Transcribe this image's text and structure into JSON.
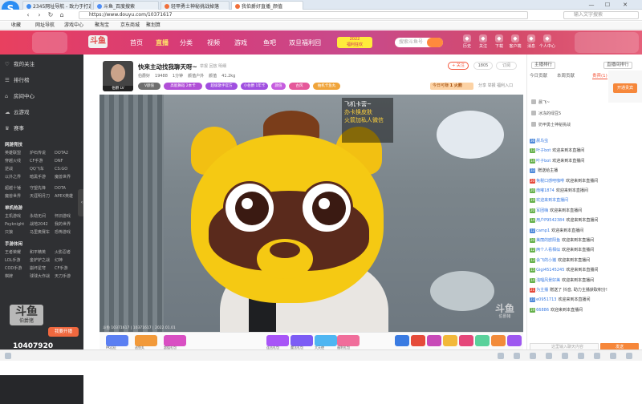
{
  "browser": {
    "tabs": [
      {
        "label": "2345网址导航 - 致力于打造",
        "color": "#3d8cf0"
      },
      {
        "label": "斗鱼_百度搜索",
        "color": "#4f8ef7"
      },
      {
        "label": "轻甲勇士神秘挑战掉落",
        "color": "#f06f3a"
      },
      {
        "label": "我伯爵好直播_颜值",
        "color": "#f06f3a"
      }
    ],
    "url": "https://www.douyu.com/10371617",
    "search_placeholder": "输入文字搜索",
    "bookmarks": [
      "收藏",
      "网址导航",
      "游戏中心",
      "聚淘宝",
      "京东商城",
      "聚划算"
    ]
  },
  "site_header": {
    "logo": "斗鱼",
    "nav": [
      "首页",
      "直播",
      "分类",
      "视频",
      "游戏",
      "鱼吧",
      "双旦福利回"
    ],
    "active_nav": "直播",
    "search_placeholder": "搜索斗鱼号",
    "icons": [
      {
        "label": "历史",
        "icon": "clock-icon"
      },
      {
        "label": "关注",
        "icon": "heart-icon"
      },
      {
        "label": "下载",
        "icon": "download-icon"
      },
      {
        "label": "客户端",
        "icon": "monitor-icon"
      },
      {
        "label": "消息",
        "icon": "message-icon"
      },
      {
        "label": "个人中心",
        "icon": "user-icon"
      }
    ]
  },
  "sidebar": {
    "items": [
      {
        "label": "我的关注",
        "icon": "heart-icon"
      },
      {
        "label": "排行榜",
        "icon": "list-icon"
      },
      {
        "label": "房间中心",
        "icon": "home-icon"
      },
      {
        "label": "云游戏",
        "icon": "cloud-icon"
      },
      {
        "label": "赛事",
        "icon": "trophy-icon"
      }
    ],
    "groups": [
      {
        "title": "网游竞技",
        "rows": [
          [
            "英雄联盟",
            "炉石传说",
            "DOTA2"
          ],
          [
            "穿越火线",
            "CF手游",
            "DNF"
          ],
          [
            "逆战",
            "QQ飞车",
            "CS:GO"
          ],
          [
            "以外之界",
            "暗黑手游",
            "魔兽世界"
          ]
        ]
      },
      {
        "title": "",
        "rows": [
          [
            "超越十锤",
            "守望先锋",
            "DOTA"
          ],
          [
            "魔兽世界",
            "天涯明月刀",
            "APEX英雄"
          ]
        ]
      },
      {
        "title": "单机热游",
        "rows": [
          [
            "主机游戏",
            "永劫无间",
            "怀旧游戏"
          ],
          [
            "Psyknight",
            "战地2042",
            "我的世界"
          ],
          [
            "只狼",
            "马里奥赛车",
            "恐怖游戏"
          ]
        ]
      },
      {
        "title": "手游休闲",
        "rows": [
          [
            "王者荣耀",
            "和平精英",
            "火影忍者"
          ],
          [
            "LOL手游",
            "金铲铲之战",
            "幻神"
          ],
          [
            "COD手游",
            "崩坏星穹",
            "CF手游"
          ],
          [
            "棋牌",
            "球球大作战",
            "天刀手游"
          ]
        ]
      }
    ],
    "dy_logo": "斗鱼",
    "dy_logo_sub": "伯爵猪",
    "start_button": "我要开播",
    "followers": "10407920"
  },
  "room": {
    "title": "快来主动找我聊天呀~",
    "subtitle": "举报  回放  明细",
    "info": [
      "伯爵好",
      "19488",
      "1分钟",
      "颜值户外",
      "颜值",
      "41.2kg"
    ],
    "badges": [
      {
        "label": "V颜值",
        "color": "#6e6e6e"
      },
      {
        "label": "高能舞蹈 2本卡",
        "color": "#b14fd7"
      },
      {
        "label": "超级歌手官方",
        "color": "#a04fe0"
      },
      {
        "label": "小伯爵 1年卡",
        "color": "#a04fe0"
      },
      {
        "label": "颜值",
        "color": "#c65cdf"
      },
      {
        "label": "古风",
        "color": "#e5589a"
      },
      {
        "label": "抽机卡鱼丸",
        "color": "#f0a43a"
      }
    ],
    "avatar_tag": "伯爵 LV",
    "follow_label": "+ 关注",
    "follow_count": "1805",
    "right_label": "订阅",
    "rank_label": "今日可赚",
    "rank_value": "1 火箭",
    "share_label": "分享  举报  福利入口"
  },
  "video": {
    "overlay_lines": [
      {
        "text": "飞机卡营~",
        "hl": false
      },
      {
        "text": "办卡换皮肤",
        "hl": true
      },
      {
        "text": "火箭加私人微信",
        "hl": true
      }
    ],
    "watermark": "斗鱼",
    "watermark_sub": "伯爵猪",
    "info": "斗鱼 10371617 | 10371617 | 2022.01.01"
  },
  "gifts": [
    {
      "label": "PK远征",
      "color": "#5b7ff2"
    },
    {
      "label": "送鱼丸",
      "color": "#f29a3a"
    },
    {
      "label": "超值礼包",
      "color": "#d94fc3"
    },
    {
      "label": "连击礼包",
      "color": "#a855f7"
    },
    {
      "label": "魔法礼包",
      "color": "#7c5cf5"
    },
    {
      "label": "大天使",
      "color": "#4fb6f2"
    },
    {
      "label": "福利礼包",
      "color": "#f06e9b"
    },
    {
      "label": "飞机",
      "color": "#3a7be2"
    },
    {
      "label": "火箭",
      "color": "#e54b3a"
    },
    {
      "label": "超火",
      "color": "#c84ab8"
    },
    {
      "label": "666",
      "color": "#f2b83a"
    },
    {
      "label": "告白",
      "color": "#e5477a"
    },
    {
      "label": "荧光棒",
      "color": "#5ad19b"
    },
    {
      "label": "棒棒",
      "color": "#f28b3a"
    },
    {
      "label": "宝箱",
      "color": "#9e58f0"
    }
  ],
  "right_panel": {
    "header_buttons": [
      "主播排行",
      "直播间排行"
    ],
    "tabs": [
      "今日贡献",
      "本周贡献",
      "贵宾(1)",
      "粉丝(1)"
    ],
    "open_button": "开通贵宾",
    "rank": [
      "晨飞~",
      "冰冻的绿豆5",
      "奶甲勇士神秘挑战"
    ],
    "chat": [
      {
        "lv": "36",
        "name": "晨鸟虫",
        "text": ""
      },
      {
        "lv": "13",
        "name": "叶子bot",
        "text": "欢迎来到本直播间"
      },
      {
        "lv": "14",
        "name": "叶子bot",
        "text": "欢迎来到本直播间"
      },
      {
        "lv": "33",
        "name": "",
        "text": "赠送给主播"
      },
      {
        "lv": "20",
        "name": "免税口感吧咖啡",
        "text": "欢迎来到本直播间"
      },
      {
        "lv": "20",
        "name": "南嘟1874",
        "text": "欢迎来到本直播间"
      },
      {
        "lv": "19",
        "name": "欢迎来到本直播间",
        "text": ""
      },
      {
        "lv": "20",
        "name": "军团嗨",
        "text": "欢迎来到本直播间"
      },
      {
        "lv": "14",
        "name": "用户P9542384",
        "text": "欢迎来到本直播间"
      },
      {
        "lv": "12",
        "name": "camp1",
        "text": "欢迎来到本直播间"
      },
      {
        "lv": "20",
        "name": "美丽的欧阳鱼",
        "text": "欢迎来到本直播间"
      },
      {
        "lv": "12",
        "name": "两个人看相似",
        "text": "欢迎来到本直播间"
      },
      {
        "lv": "13",
        "name": "会飞的小猪",
        "text": "欢迎来到本直播间"
      },
      {
        "lv": "15",
        "name": "Gigi45145245",
        "text": "欢迎来到本直播间"
      },
      {
        "lv": "14",
        "name": "浅唱风景好美",
        "text": "欢迎来到本直播间"
      },
      {
        "lv": "21",
        "name": "为主播",
        "text": "赠送了 抖音, 助力主播获取积分!"
      },
      {
        "lv": "23",
        "name": "e0951713",
        "text": "欢迎来到本直播间"
      },
      {
        "lv": "19",
        "name": "66886",
        "text": "欢迎来到本直播间"
      }
    ],
    "input_placeholder": "这里输入聊天内容",
    "send_label": "发送"
  }
}
